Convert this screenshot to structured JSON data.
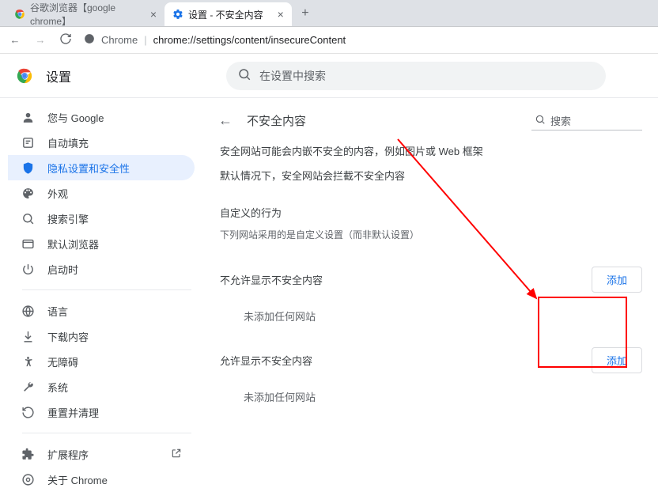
{
  "tabs": [
    {
      "title": "谷歌浏览器【google chrome】"
    },
    {
      "title": "设置 - 不安全内容"
    }
  ],
  "url": "chrome://settings/content/insecureContent",
  "urlPrefix": "Chrome",
  "header": {
    "title": "设置",
    "searchPlaceholder": "在设置中搜索"
  },
  "sidebar": {
    "items": [
      {
        "label": "您与 Google"
      },
      {
        "label": "自动填充"
      },
      {
        "label": "隐私设置和安全性"
      },
      {
        "label": "外观"
      },
      {
        "label": "搜索引擎"
      },
      {
        "label": "默认浏览器"
      },
      {
        "label": "启动时"
      }
    ],
    "items2": [
      {
        "label": "语言"
      },
      {
        "label": "下载内容"
      },
      {
        "label": "无障碍"
      },
      {
        "label": "系统"
      },
      {
        "label": "重置并清理"
      }
    ],
    "extensions": "扩展程序",
    "about": "关于 Chrome"
  },
  "content": {
    "backPageTitle": "不安全内容",
    "searchPlaceholder": "搜索",
    "desc1": "安全网站可能会内嵌不安全的内容，例如图片或 Web 框架",
    "desc2": "默认情况下，安全网站会拦截不安全内容",
    "customTitle": "自定义的行为",
    "customSub": "下列网站采用的是自定义设置（而非默认设置）",
    "block": {
      "title": "不允许显示不安全内容",
      "empty": "未添加任何网站",
      "add": "添加"
    },
    "allow": {
      "title": "允许显示不安全内容",
      "empty": "未添加任何网站",
      "add": "添加"
    }
  }
}
